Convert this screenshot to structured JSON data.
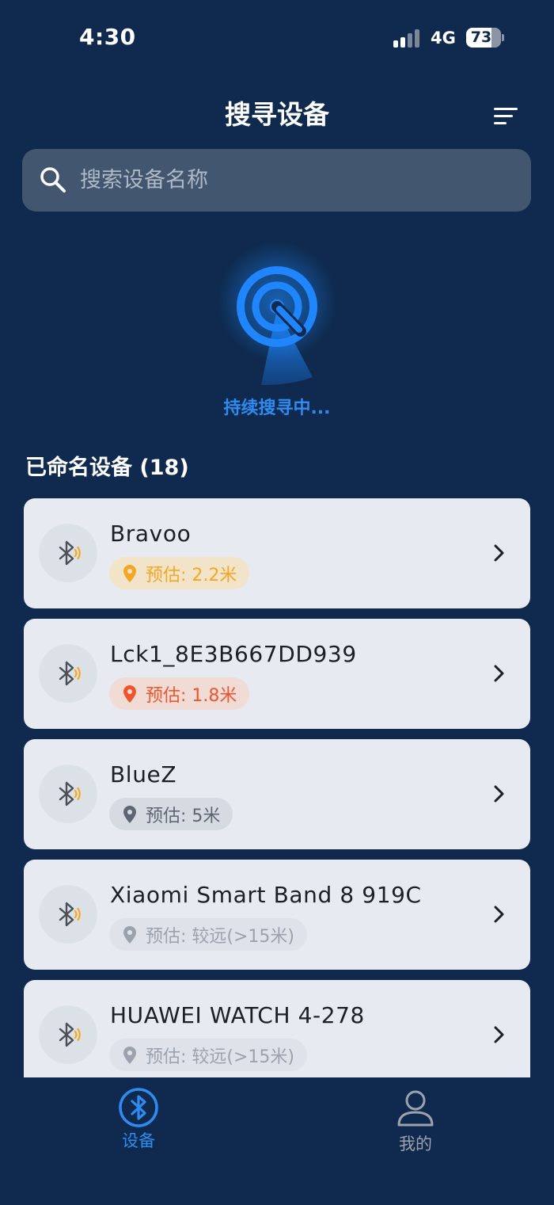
{
  "status_bar": {
    "time": "4:30",
    "network": "4G",
    "battery": "73"
  },
  "header": {
    "title": "搜寻设备",
    "sort_icon": "sort-lines-icon"
  },
  "search": {
    "placeholder": "搜索设备名称",
    "value": ""
  },
  "radar": {
    "status": "持续搜寻中..."
  },
  "section": {
    "title": "已命名设备 (18)"
  },
  "colors": {
    "background": "#0f2a4e",
    "accent": "#2e8cf0",
    "card": "#e7ebf1",
    "near": "#f5a623",
    "very_near": "#f0542d",
    "mid": "#5f6673",
    "far": "#9ba2ad"
  },
  "devices": [
    {
      "name": "Bravoo",
      "distance": "预估: 2.2米",
      "level": "near"
    },
    {
      "name": "Lck1_8E3B667DD939",
      "distance": "预估: 1.8米",
      "level": "very_near"
    },
    {
      "name": "BlueZ",
      "distance": "预估: 5米",
      "level": "mid"
    },
    {
      "name": "Xiaomi Smart Band 8 919C",
      "distance": "预估: 较远(>15米)",
      "level": "far"
    },
    {
      "name": "HUAWEI WATCH 4-278",
      "distance": "预估: 较远(>15米)",
      "level": "far"
    }
  ],
  "tabs": [
    {
      "label": "设备",
      "icon": "bluetooth-icon",
      "active": true
    },
    {
      "label": "我的",
      "icon": "person-icon",
      "active": false
    }
  ]
}
